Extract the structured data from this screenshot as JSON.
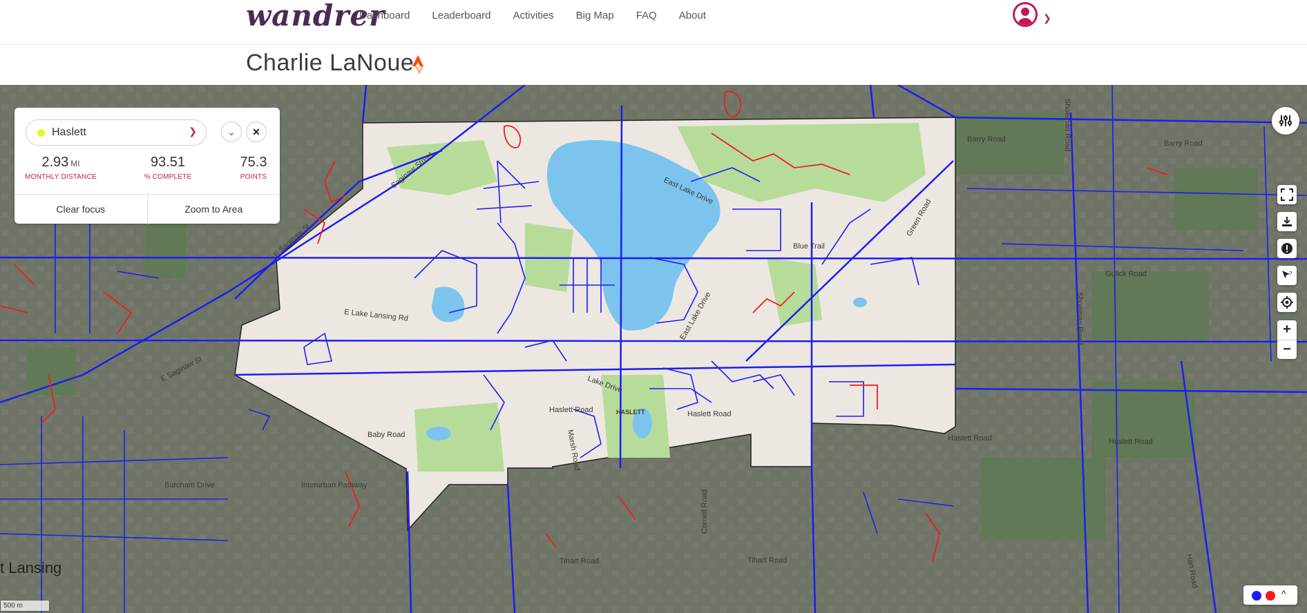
{
  "brand": {
    "logo": "wandrer"
  },
  "nav": {
    "items": [
      "Dashboard",
      "Leaderboard",
      "Activities",
      "Big Map",
      "FAQ",
      "About"
    ]
  },
  "page": {
    "title": "Charlie LaNoue"
  },
  "area_panel": {
    "area_name": "Haslett",
    "area_dot_color": "#f1f12a",
    "stats": [
      {
        "value": "2.93",
        "unit": "MI",
        "label": "MONTHLY DISTANCE"
      },
      {
        "value": "93.51",
        "unit": "",
        "label": "% COMPLETE"
      },
      {
        "value": "75.3",
        "unit": "",
        "label": "POINTS"
      }
    ],
    "clear_focus": "Clear focus",
    "zoom_to_area": "Zoom to Area"
  },
  "map": {
    "labels": {
      "haslett_road": "Haslett Road",
      "haslett_road_2": "Haslett Road",
      "haslett_road_3": "Haslett Road",
      "haslett_road_4": "Haslett Road",
      "haslett_town": "HASLETT",
      "barry_road": "Barry Road",
      "barry_road_2": "Barry Road",
      "gulick_road": "Gulick Road",
      "blue_trail": "Blue Trail",
      "east_lake_drive": "East Lake Drive",
      "east_lake_drive_2": "East Lake Drive",
      "lake_drive": "Lake Drive",
      "e_lake_lansing_rd": "E Lake Lansing Rd",
      "e_saginaw_st": "E Saginaw St",
      "e_saginaw_st_2": "E Saginaw St",
      "saginaw_street": "Saginaw Street",
      "baby_road": "Baby Road",
      "burcham_drive": "Burcham Drive",
      "interurban_pathway": "Interurban Pathway",
      "tihart_road": "Tihart Road",
      "tihart_road_2": "Tihart Road",
      "cornell_road": "Cornell Road",
      "marsh_road": "Marsh Road",
      "green_road": "Green Road",
      "shoeman_road": "Shoeman Road",
      "shoeman_road_2": "Shoeman Road",
      "hart_road": "Hart Road",
      "lansing": "t Lansing"
    },
    "scale": "500 m",
    "colors": {
      "traveled": "#1c1cf5",
      "untraveled": "#f31b1b",
      "water": "#7cc4ee",
      "park": "#b7dc9a",
      "land": "#ece7e1",
      "outside": "#6f7566"
    }
  },
  "legend": {
    "traveled_color": "#1c1cf5",
    "untraveled_color": "#f31b1b",
    "toggle": "^"
  }
}
